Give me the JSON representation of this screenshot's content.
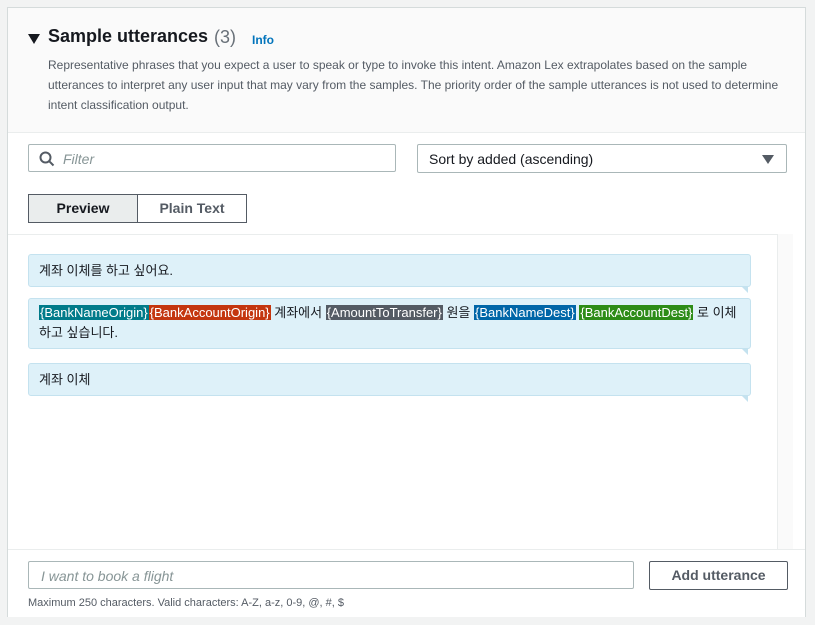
{
  "section": {
    "title": "Sample utterances",
    "count": "(3)",
    "info_link": "Info",
    "description": "Representative phrases that you expect a user to speak or type to invoke this intent. Amazon Lex extrapolates based on the sample utterances to interpret any user input that may vary from the samples. The priority order of the sample utterances is not used to determine intent classification output."
  },
  "filter": {
    "placeholder": "Filter",
    "icon": "search-icon"
  },
  "sort": {
    "selected": "Sort by added (ascending)"
  },
  "view_toggle": {
    "preview": "Preview",
    "plain_text": "Plain Text",
    "active": "Preview"
  },
  "utterances": [
    {
      "text": "계좌 이체를 하고 싶어요."
    },
    {
      "slot_bank_origin": "{BankNameOrigin}",
      "slot_account_origin": "{BankAccountOrigin}",
      "text_1": " 계좌에서 ",
      "slot_amount": "{AmountToTransfer}",
      "text_2": " 원을 ",
      "slot_bank_dest": "{BankNameDest}",
      "text_3": " ",
      "slot_account_dest": "{BankAccountDest}",
      "text_4": " 로 이체하고 싶습니다."
    },
    {
      "text": "계좌 이체"
    }
  ],
  "new_utterance": {
    "placeholder": "I want to book a flight",
    "value": ""
  },
  "add_button": "Add utterance",
  "hint": "Maximum 250 characters. Valid characters: A-Z, a-z, 0-9, @, #, $",
  "colors": {
    "slot_bank_origin": "#007b8a",
    "slot_account_origin": "#c4360f",
    "slot_amount": "#545b64",
    "slot_bank_dest": "#0066a8",
    "slot_account_dest": "#2d8c17",
    "bubble": "#def1f9",
    "link": "#0073bb"
  }
}
